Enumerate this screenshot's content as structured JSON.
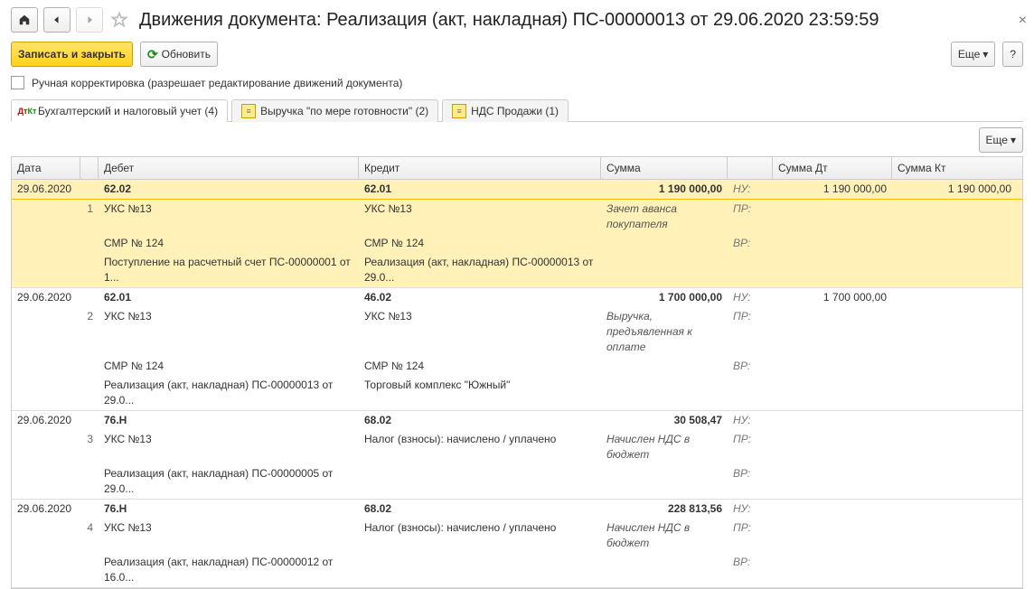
{
  "header": {
    "title": "Движения документа: Реализация (акт, накладная) ПС-00000013 от 29.06.2020 23:59:59"
  },
  "toolbar2": {
    "save_close": "Записать и закрыть",
    "refresh": "Обновить",
    "more": "Еще",
    "help": "?"
  },
  "manual_correction": "Ручная корректировка (разрешает редактирование движений документа)",
  "tabs": [
    {
      "label": "Бухгалтерский и налоговый учет (4)"
    },
    {
      "label": "Выручка \"по мере готовности\" (2)"
    },
    {
      "label": "НДС Продажи (1)"
    }
  ],
  "more2": "Еще",
  "grid_headers": {
    "date": "Дата",
    "debit": "Дебет",
    "credit": "Кредит",
    "sum": "Сумма",
    "sum_dt": "Сумма Дт",
    "sum_kt": "Сумма Кт"
  },
  "tags": {
    "nu": "НУ:",
    "pr": "ПР:",
    "vr": "ВР:"
  },
  "entries": [
    {
      "hl": true,
      "date": "29.06.2020",
      "num": "1",
      "d_acc": "62.02",
      "c_acc": "62.01",
      "sum": "1 190 000,00",
      "d1": "УКС №13",
      "c1": "УКС №13",
      "comment": "Зачет аванса покупателя",
      "d2": "СМР № 124",
      "c2": "СМР № 124",
      "d3": "Поступление на расчетный счет ПС-00000001 от 1...",
      "c3": "Реализация (акт, накладная) ПС-00000013 от 29.0...",
      "dt": "1 190 000,00",
      "kt": "1 190 000,00"
    },
    {
      "date": "29.06.2020",
      "num": "2",
      "d_acc": "62.01",
      "c_acc": "46.02",
      "sum": "1 700 000,00",
      "d1": "УКС №13",
      "c1": "УКС №13",
      "comment": "Выручка, предъявленная к оплате",
      "d2": "СМР № 124",
      "c2": "СМР № 124",
      "d3": "Реализация (акт, накладная) ПС-00000013 от 29.0...",
      "c3": "Торговый комплекс \"Южный\"",
      "dt": "1 700 000,00",
      "kt": ""
    },
    {
      "date": "29.06.2020",
      "num": "3",
      "d_acc": "76.Н",
      "c_acc": "68.02",
      "sum": "30 508,47",
      "d1": "УКС №13",
      "c1": "Налог (взносы): начислено / уплачено",
      "comment": "Начислен НДС в бюджет",
      "d2": "Реализация (акт, накладная) ПС-00000005 от 29.0...",
      "c2": "",
      "dt": "",
      "kt": ""
    },
    {
      "date": "29.06.2020",
      "num": "4",
      "d_acc": "76.Н",
      "c_acc": "68.02",
      "sum": "228 813,56",
      "d1": "УКС №13",
      "c1": "Налог (взносы): начислено / уплачено",
      "comment": "Начислен НДС в бюджет",
      "d2": "Реализация (акт, накладная) ПС-00000012 от 16.0...",
      "c2": "",
      "dt": "",
      "kt": ""
    }
  ]
}
